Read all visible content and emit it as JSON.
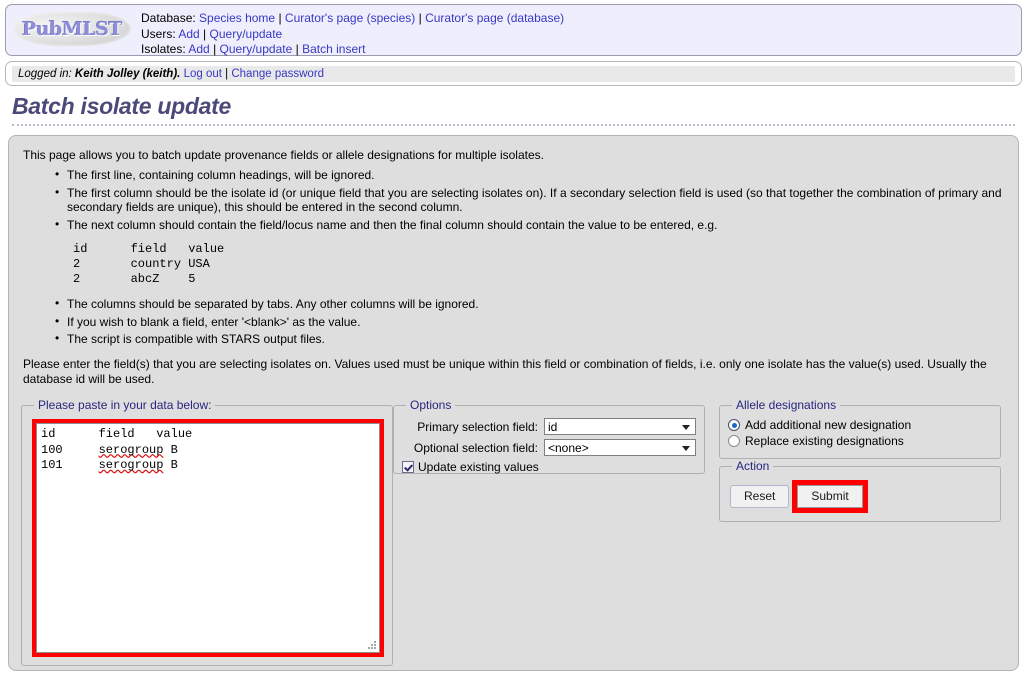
{
  "header": {
    "logo_text": "PubMLST",
    "rows": [
      {
        "label": "Database:",
        "links": [
          "Species home",
          "Curator's page (species)",
          "Curator's page (database)"
        ]
      },
      {
        "label": "Users:",
        "links": [
          "Add",
          "Query/update"
        ]
      },
      {
        "label": "Isolates:",
        "links": [
          "Add",
          "Query/update",
          "Batch insert"
        ]
      }
    ]
  },
  "login": {
    "prefix": "Logged in:",
    "user": "Keith Jolley (keith).",
    "logout": "Log out",
    "change_password": "Change password",
    "separator": "|"
  },
  "page_title": "Batch isolate update",
  "content": {
    "intro": "This page allows you to batch update provenance fields or allele designations for multiple isolates.",
    "rules": [
      "The first line, containing column headings, will be ignored.",
      "The first column should be the isolate id (or unique field that you are selecting isolates on). If a secondary selection field is used (so that together the combination of primary and secondary fields are unique), this should be entered in the second column.",
      "The next column should contain the field/locus name and then the final column should contain the value to be entered, e.g."
    ],
    "example": "id      field   value\n2       country USA\n2       abcZ    5",
    "rules2": [
      "The columns should be separated by tabs. Any other columns will be ignored.",
      "If you wish to blank a field, enter '<blank>' as the value.",
      "The script is compatible with STARS output files."
    ],
    "closing": "Please enter the field(s) that you are selecting isolates on. Values used must be unique within this field or combination of fields, i.e. only one isolate has the value(s) used. Usually the database id will be used."
  },
  "data_fieldset": {
    "legend": "Please paste in your data below:",
    "line1_pre": "id      field   value",
    "line2_id": "100     ",
    "line2_field": "serogroup",
    "line2_value": " B",
    "line3_id": "101     ",
    "line3_field": "serogroup",
    "line3_value": " B"
  },
  "options_fieldset": {
    "legend": "Options",
    "primary_label": "Primary selection field:",
    "primary_value": "id",
    "optional_label": "Optional selection field:",
    "optional_value": "<none>",
    "checkbox_label": "Update existing values",
    "checkbox_checked": true
  },
  "allele_fieldset": {
    "legend": "Allele designations",
    "option_add": "Add additional new designation",
    "option_replace": "Replace existing designations",
    "selected": "add"
  },
  "action_fieldset": {
    "legend": "Action",
    "reset_label": "Reset",
    "submit_label": "Submit"
  },
  "colors": {
    "link": "#3939c4",
    "legend": "#27277e",
    "title": "#4a4a78",
    "highlight": "#ff0000",
    "panel_bg": "#dedede",
    "header_bg": "#eeeefc"
  }
}
